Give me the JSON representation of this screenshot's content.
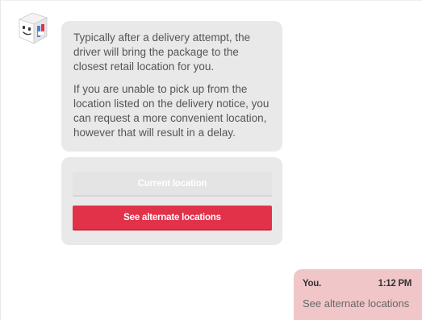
{
  "bot": {
    "avatar_icon": "box-robot-icon",
    "message_paragraphs": [
      "Typically after a delivery attempt, the driver will bring the package to the closest retail location for you.",
      "If you are unable to pick up from the location listed on the delivery notice, you can request a more convenient location, however that will result in a delay."
    ]
  },
  "options": {
    "current_label": "Current location",
    "alternate_label": "See alternate locations"
  },
  "reply": {
    "sender": "You.",
    "time": "1:12 PM",
    "text": "See alternate locations"
  },
  "colors": {
    "bot_bubble": "#e9e9e9",
    "primary_button": "#e1324a",
    "disabled_button": "#e4e4e4",
    "user_bubble": "#f1c6c9"
  }
}
